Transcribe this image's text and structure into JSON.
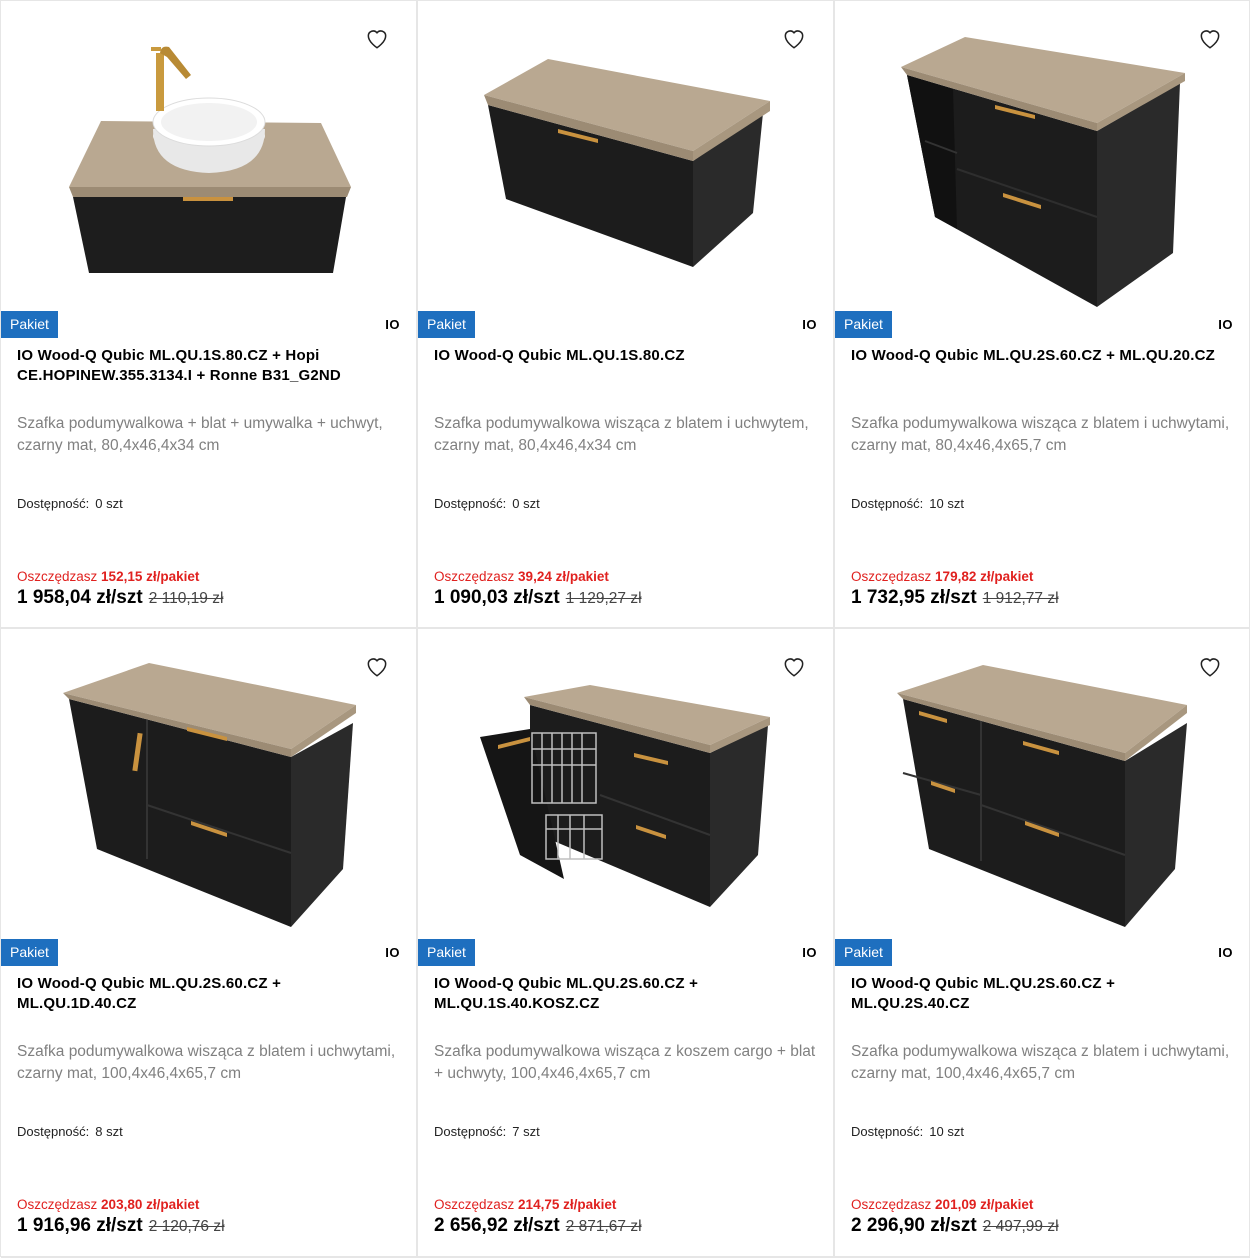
{
  "colors": {
    "badge": "#1e6fbf",
    "savings": "#e0211f",
    "description": "#808080",
    "cabinet": "#1d1d1d",
    "wood_top": "#b9a891",
    "handle": "#c9923f"
  },
  "products": [
    {
      "badge": "Pakiet",
      "brand": "IO",
      "title": "IO Wood-Q Qubic ML.QU.1S.80.CZ + Hopi CE.HOPINEW.355.3134.I + Ronne B31_G2ND",
      "description": "Szafka podumywalkowa + blat + umywalka + uchwyt, czarny mat, 80,4x46,4x34 cm",
      "availability_label": "Dostępność:",
      "availability_value": "0 szt",
      "savings_label": "Oszczędzasz",
      "savings_value": "152,15 zł/pakiet",
      "price": "1 958,04 zł/szt",
      "old_price": "2 110,19 zł",
      "image_icon": "vanity-with-basin-image"
    },
    {
      "badge": "Pakiet",
      "brand": "IO",
      "title": "IO Wood-Q Qubic ML.QU.1S.80.CZ",
      "description": "Szafka podumywalkowa wisząca z blatem i uchwytem, czarny mat, 80,4x46,4x34 cm",
      "availability_label": "Dostępność:",
      "availability_value": "0 szt",
      "savings_label": "Oszczędzasz",
      "savings_value": "39,24 zł/pakiet",
      "price": "1 090,03 zł/szt",
      "old_price": "1 129,27 zł",
      "image_icon": "single-drawer-cabinet-image"
    },
    {
      "badge": "Pakiet",
      "brand": "IO",
      "title": "IO Wood-Q Qubic ML.QU.2S.60.CZ + ML.QU.20.CZ",
      "description": "Szafka podumywalkowa wisząca z blatem i uchwytami, czarny mat, 80,4x46,4x65,7 cm",
      "availability_label": "Dostępność:",
      "availability_value": "10 szt",
      "savings_label": "Oszczędzasz",
      "savings_value": "179,82 zł/pakiet",
      "price": "1 732,95 zł/szt",
      "old_price": "1 912,77 zł",
      "image_icon": "two-drawer-shelf-cabinet-image"
    },
    {
      "badge": "Pakiet",
      "brand": "IO",
      "title": "IO Wood-Q Qubic ML.QU.2S.60.CZ + ML.QU.1D.40.CZ",
      "description": "Szafka podumywalkowa wisząca z blatem i uchwytami, czarny mat, 100,4x46,4x65,7 cm",
      "availability_label": "Dostępność:",
      "availability_value": "8 szt",
      "savings_label": "Oszczędzasz",
      "savings_value": "203,80 zł/pakiet",
      "price": "1 916,96 zł/szt",
      "old_price": "2 120,76 zł",
      "image_icon": "door-and-drawers-cabinet-image"
    },
    {
      "badge": "Pakiet",
      "brand": "IO",
      "title": "IO Wood-Q Qubic ML.QU.2S.60.CZ + ML.QU.1S.40.KOSZ.CZ",
      "description": "Szafka podumywalkowa wisząca z koszem cargo + blat + uchwyty, 100,4x46,4x65,7 cm",
      "availability_label": "Dostępność:",
      "availability_value": "7 szt",
      "savings_label": "Oszczędzasz",
      "savings_value": "214,75 zł/pakiet",
      "price": "2 656,92 zł/szt",
      "old_price": "2 871,67 zł",
      "image_icon": "cargo-basket-cabinet-image"
    },
    {
      "badge": "Pakiet",
      "brand": "IO",
      "title": "IO Wood-Q Qubic ML.QU.2S.60.CZ + ML.QU.2S.40.CZ",
      "description": "Szafka podumywalkowa wisząca z blatem i uchwytami, czarny mat, 100,4x46,4x65,7 cm",
      "availability_label": "Dostępność:",
      "availability_value": "10 szt",
      "savings_label": "Oszczędzasz",
      "savings_value": "201,09 zł/pakiet",
      "price": "2 296,90 zł/szt",
      "old_price": "2 497,99 zł",
      "image_icon": "four-drawer-cabinet-image"
    }
  ]
}
